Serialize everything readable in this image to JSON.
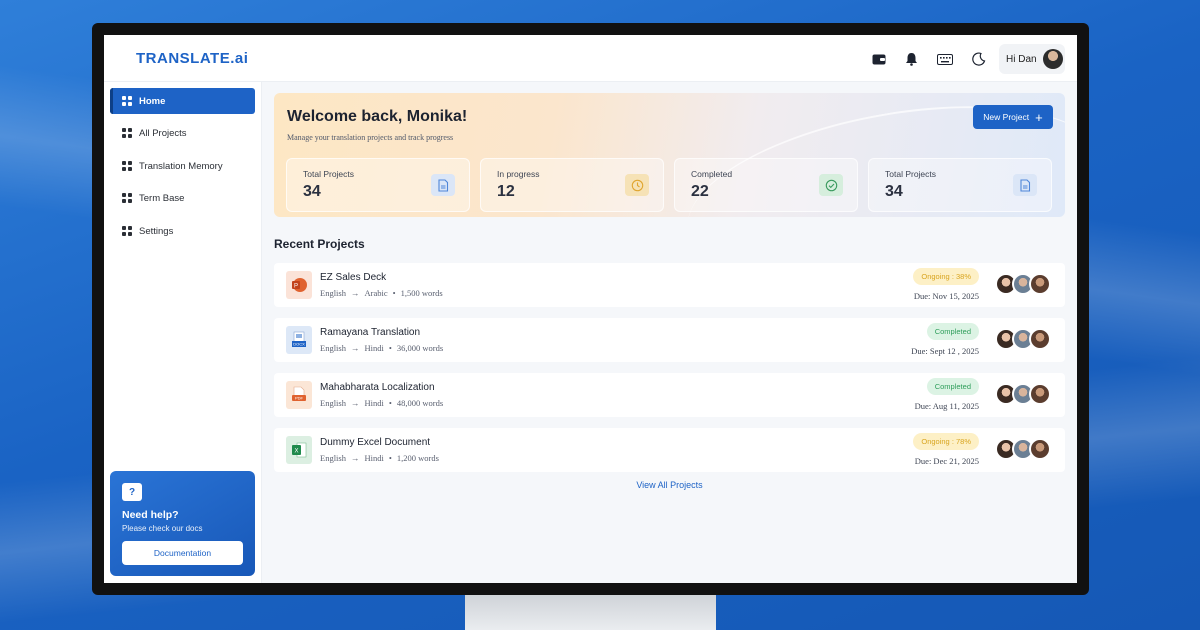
{
  "app": {
    "logo": "TRANSLATE.ai"
  },
  "header": {
    "greeting": "Hi Dan",
    "icons": [
      "wallet-icon",
      "bell-icon",
      "keyboard-icon",
      "moon-icon"
    ]
  },
  "sidebar": {
    "items": [
      {
        "label": "Home",
        "active": true
      },
      {
        "label": "All Projects",
        "active": false
      },
      {
        "label": "Translation Memory",
        "active": false
      },
      {
        "label": "Term Base",
        "active": false
      },
      {
        "label": "Settings",
        "active": false
      }
    ],
    "help": {
      "title": "Need help?",
      "subtitle": "Please check our docs",
      "button": "Documentation"
    }
  },
  "welcome": {
    "title": "Welcome back, Monika!",
    "subtitle": "Manage your translation projects and track progress",
    "new_project": "New Project"
  },
  "stats": [
    {
      "label": "Total Projects",
      "value": "34",
      "icon": "document-icon",
      "color": "#4f86d9"
    },
    {
      "label": "In progress",
      "value": "12",
      "icon": "clock-icon",
      "color": "#e0a530"
    },
    {
      "label": "Completed",
      "value": "22",
      "icon": "check-circle-icon",
      "color": "#3a9a5e"
    },
    {
      "label": "Total Projects",
      "value": "34",
      "icon": "document-icon",
      "color": "#4f86d9"
    }
  ],
  "recent": {
    "title": "Recent Projects",
    "view_all": "View All Projects",
    "projects": [
      {
        "name": "EZ Sales Deck",
        "from": "English",
        "to": "Arabic",
        "words": "1,500 words",
        "status": "Ongoing : 38%",
        "status_type": "ongoing",
        "due": "Due: Nov 15, 2025",
        "file": "ppt"
      },
      {
        "name": "Ramayana Translation",
        "from": "English",
        "to": "Hindi",
        "words": "36,000 words",
        "status": "Completed",
        "status_type": "done",
        "due": "Due: Sept 12 , 2025",
        "file": "docx"
      },
      {
        "name": "Mahabharata Localization",
        "from": "English",
        "to": "Hindi",
        "words": "48,000 words",
        "status": "Completed",
        "status_type": "done",
        "due": "Due: Aug 11, 2025",
        "file": "pdf"
      },
      {
        "name": "Dummy Excel Document",
        "from": "English",
        "to": "Hindi",
        "words": "1,200 words",
        "status": "Ongoing : 78%",
        "status_type": "ongoing",
        "due": "Due: Dec 21, 2025",
        "file": "xls"
      }
    ]
  },
  "colors": {
    "accent": "#1e63c6",
    "ongoing": "#d9a520",
    "completed": "#2f9e5b"
  }
}
